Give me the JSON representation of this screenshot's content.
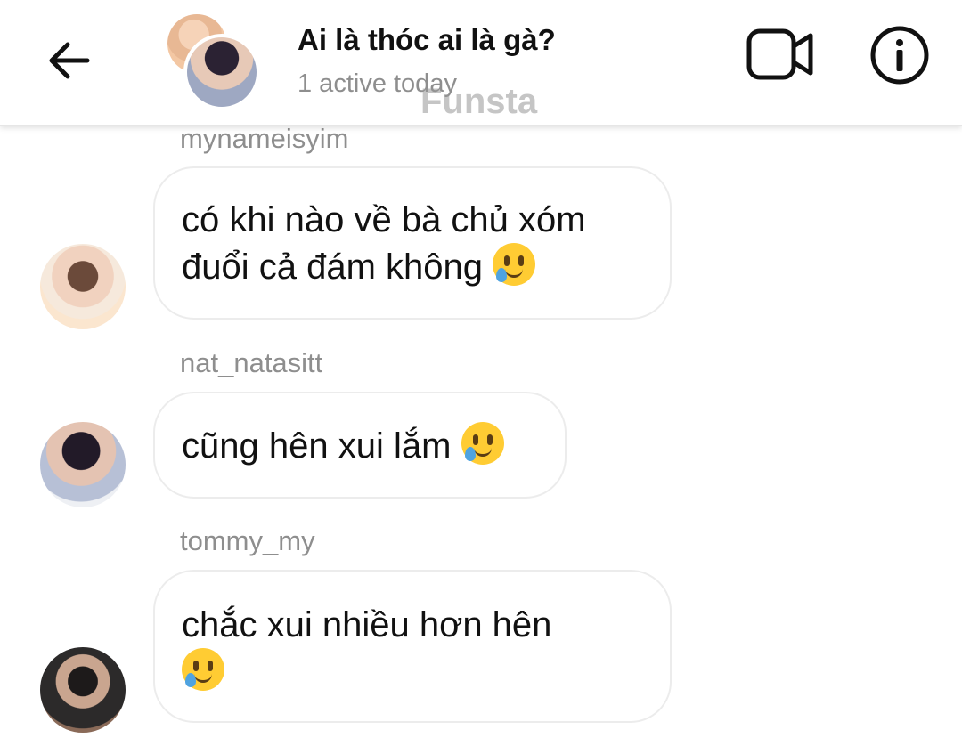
{
  "header": {
    "title": "Ai là thóc ai là gà?",
    "status": "1 active today",
    "watermark": "Funsta"
  },
  "icons": {
    "back": "back-arrow-icon",
    "video": "video-camera-icon",
    "info": "info-icon",
    "emoji": "smiling-face-with-tear-emoji"
  },
  "messages": [
    {
      "sender": "mynameisyim",
      "lines": [
        "có khi nào về bà chủ xóm",
        "đuổi cả đám không"
      ]
    },
    {
      "sender": "nat_natasitt",
      "lines": [
        "cũng hên xui lắm"
      ]
    },
    {
      "sender": "tommy_my",
      "lines": [
        "chắc xui nhiều hơn hên"
      ]
    }
  ]
}
